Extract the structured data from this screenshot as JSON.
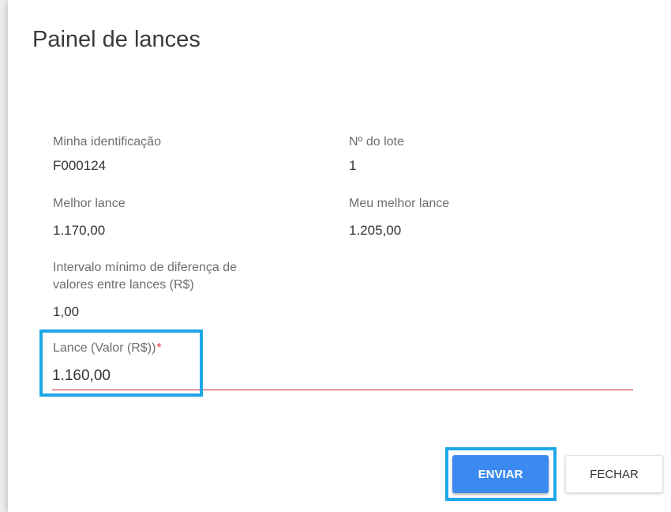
{
  "dialog": {
    "title": "Painel de lances"
  },
  "fields": {
    "minha_identificacao": {
      "label": "Minha identificação",
      "value": "F000124"
    },
    "numero_lote": {
      "label": "Nº do lote",
      "value": "1"
    },
    "melhor_lance": {
      "label": "Melhor lance",
      "value": "1.170,00"
    },
    "meu_melhor_lance": {
      "label": "Meu melhor lance",
      "value": "1.205,00"
    },
    "intervalo_minimo": {
      "label_line1": "Intervalo mínimo de diferença de",
      "label_line2": "valores entre lances (R$)",
      "value": "1,00"
    }
  },
  "lance_input": {
    "label": "Lance (Valor (R$))",
    "required_marker": "*",
    "value": "1.160,00"
  },
  "buttons": {
    "send_label": "ENVIAR",
    "close_label": "FECHAR"
  },
  "colors": {
    "primary": "#3c8af0",
    "highlight": "#1ea7e6",
    "error_underline": "#c62828",
    "required": "#e53935"
  }
}
